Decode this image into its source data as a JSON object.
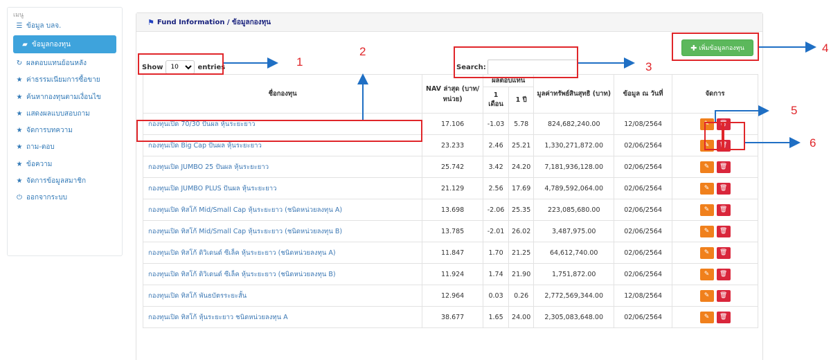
{
  "sidebar": {
    "header": "เมนู",
    "items": [
      {
        "label": "ข้อมูล บลจ.",
        "icon": "list-icon",
        "glyph": "☰",
        "active": false
      },
      {
        "label": "ข้อมูลกองทุน",
        "icon": "folder-open-icon",
        "glyph": "▰",
        "active": true
      },
      {
        "label": "ผลตอบแทนย้อนหลัง",
        "icon": "refresh-icon",
        "glyph": "↻",
        "active": false
      },
      {
        "label": "ค่าธรรมเนียมการซื้อขาย",
        "icon": "star-icon",
        "glyph": "★",
        "active": false
      },
      {
        "label": "ค้นหากองทุนตามเงื่อนไข",
        "icon": "star-icon",
        "glyph": "★",
        "active": false
      },
      {
        "label": "แสดงผลแบบสอบถาม",
        "icon": "star-icon",
        "glyph": "★",
        "active": false
      },
      {
        "label": "จัดการบทความ",
        "icon": "star-icon",
        "glyph": "★",
        "active": false
      },
      {
        "label": "ถาม-ตอบ",
        "icon": "star-icon",
        "glyph": "★",
        "active": false
      },
      {
        "label": "ข้อความ",
        "icon": "star-icon",
        "glyph": "★",
        "active": false
      },
      {
        "label": "จัดการข้อมูลสมาชิก",
        "icon": "star-icon",
        "glyph": "★",
        "active": false
      },
      {
        "label": "ออกจากระบบ",
        "icon": "power-icon",
        "glyph": "⏻",
        "active": false
      }
    ]
  },
  "panel": {
    "title": "Fund Information / ข้อมูลกองทุน",
    "add_button": "เพิ่มข้อมูลกองทุน",
    "show_label": "Show",
    "entries_value": "10",
    "entries_label": "entries",
    "search_label": "Search:",
    "search_value": ""
  },
  "table": {
    "headers": {
      "name": "ชื่อกองทุน",
      "nav": "NAV ล่าสุด (บาท/หน่วย)",
      "returns": "ผลตอบแทน",
      "return_1m": "1 เดือน",
      "return_1y": "1 ปี",
      "net_asset": "มูลค่าทรัพย์สินสุทธิ (บาท)",
      "as_of": "ข้อมูล ณ วันที่",
      "manage": "จัดการ"
    },
    "rows": [
      {
        "name": "กองทุนเปิด 70/30 ปันผล หุ้นระยะยาว",
        "nav": "17.106",
        "r1m": "-1.03",
        "r1y": "5.78",
        "asset": "824,682,240.00",
        "date": "12/08/2564"
      },
      {
        "name": "กองทุนเปิด Big Cap ปันผล หุ้นระยะยาว",
        "nav": "23.233",
        "r1m": "2.46",
        "r1y": "25.21",
        "asset": "1,330,271,872.00",
        "date": "02/06/2564"
      },
      {
        "name": "กองทุนเปิด JUMBO 25 ปันผล หุ้นระยะยาว",
        "nav": "25.742",
        "r1m": "3.42",
        "r1y": "24.20",
        "asset": "7,181,936,128.00",
        "date": "02/06/2564"
      },
      {
        "name": "กองทุนเปิด JUMBO PLUS ปันผล หุ้นระยะยาว",
        "nav": "21.129",
        "r1m": "2.56",
        "r1y": "17.69",
        "asset": "4,789,592,064.00",
        "date": "02/06/2564"
      },
      {
        "name": "กองทุนเปิด ทิสโก้ Mid/Small Cap หุ้นระยะยาว (ชนิดหน่วยลงทุน A)",
        "nav": "13.698",
        "r1m": "-2.06",
        "r1y": "25.35",
        "asset": "223,085,680.00",
        "date": "02/06/2564"
      },
      {
        "name": "กองทุนเปิด ทิสโก้ Mid/Small Cap หุ้นระยะยาว (ชนิดหน่วยลงทุน B)",
        "nav": "13.785",
        "r1m": "-2.01",
        "r1y": "26.02",
        "asset": "3,487,975.00",
        "date": "02/06/2564"
      },
      {
        "name": "กองทุนเปิด ทิสโก้ ดิวิเดนด์ ซีเล็ค หุ้นระยะยาว (ชนิดหน่วยลงทุน A)",
        "nav": "11.847",
        "r1m": "1.70",
        "r1y": "21.25",
        "asset": "64,612,740.00",
        "date": "02/06/2564"
      },
      {
        "name": "กองทุนเปิด ทิสโก้ ดิวิเดนด์ ซีเล็ค หุ้นระยะยาว (ชนิดหน่วยลงทุน B)",
        "nav": "11.924",
        "r1m": "1.74",
        "r1y": "21.90",
        "asset": "1,751,872.00",
        "date": "02/06/2564"
      },
      {
        "name": "กองทุนเปิด ทิสโก้ พันธบัตรระยะสั้น",
        "nav": "12.964",
        "r1m": "0.03",
        "r1y": "0.26",
        "asset": "2,772,569,344.00",
        "date": "12/08/2564"
      },
      {
        "name": "กองทุนเปิด ทิสโก้ หุ้นระยะยาว ชนิดหน่วยลงทุน A",
        "nav": "38.677",
        "r1m": "1.65",
        "r1y": "24.00",
        "asset": "2,305,083,648.00",
        "date": "02/06/2564"
      }
    ]
  },
  "annotations": {
    "labels": [
      "1",
      "2",
      "3",
      "4",
      "5",
      "6"
    ],
    "color": "#e0262a",
    "arrow_color": "#1f6fc4"
  },
  "colors": {
    "active_menu": "#3ea3dc",
    "link": "#3c78b4",
    "add_button": "#5cb85c",
    "edit_button": "#f0801c",
    "delete_button": "#d9263b"
  }
}
